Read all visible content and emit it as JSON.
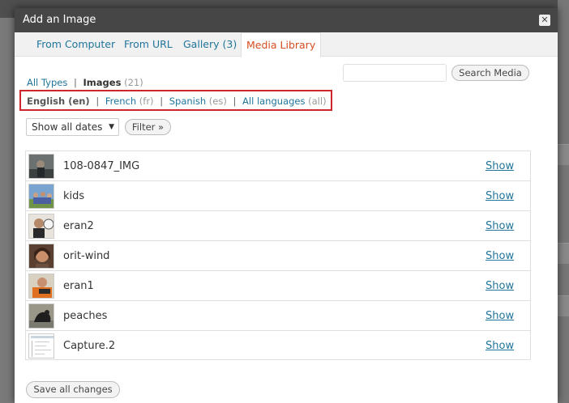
{
  "dialog": {
    "title": "Add an Image",
    "close_glyph": "✕"
  },
  "tabs": [
    {
      "label": "From Computer"
    },
    {
      "label": "From URL"
    },
    {
      "label": "Gallery (3)"
    },
    {
      "label": "Media Library",
      "active": true
    }
  ],
  "search": {
    "input_value": "",
    "button_label": "Search Media"
  },
  "types": {
    "all_label": "All Types",
    "separator": "|",
    "images_label": "Images",
    "images_count": "(21)"
  },
  "languages": {
    "english": {
      "label": "English (en)"
    },
    "french": {
      "label": "French",
      "code": "(fr)"
    },
    "spanish": {
      "label": "Spanish",
      "code": "(es)"
    },
    "all": {
      "label": "All languages",
      "code": "(all)"
    },
    "separator": "|"
  },
  "filters": {
    "date_selected": "Show all dates",
    "filter_button": "Filter »"
  },
  "media_items": [
    {
      "title": "108-0847_IMG",
      "action": "Show"
    },
    {
      "title": "kids",
      "action": "Show"
    },
    {
      "title": "eran2",
      "action": "Show"
    },
    {
      "title": "orit-wind",
      "action": "Show"
    },
    {
      "title": "eran1",
      "action": "Show"
    },
    {
      "title": "peaches",
      "action": "Show"
    },
    {
      "title": "Capture.2",
      "action": "Show"
    }
  ],
  "footer": {
    "save_label": "Save all changes"
  },
  "colors": {
    "link": "#21759b",
    "active_tab": "#d54e21",
    "header_bg": "#464646",
    "highlight_border": "#d0252a"
  }
}
